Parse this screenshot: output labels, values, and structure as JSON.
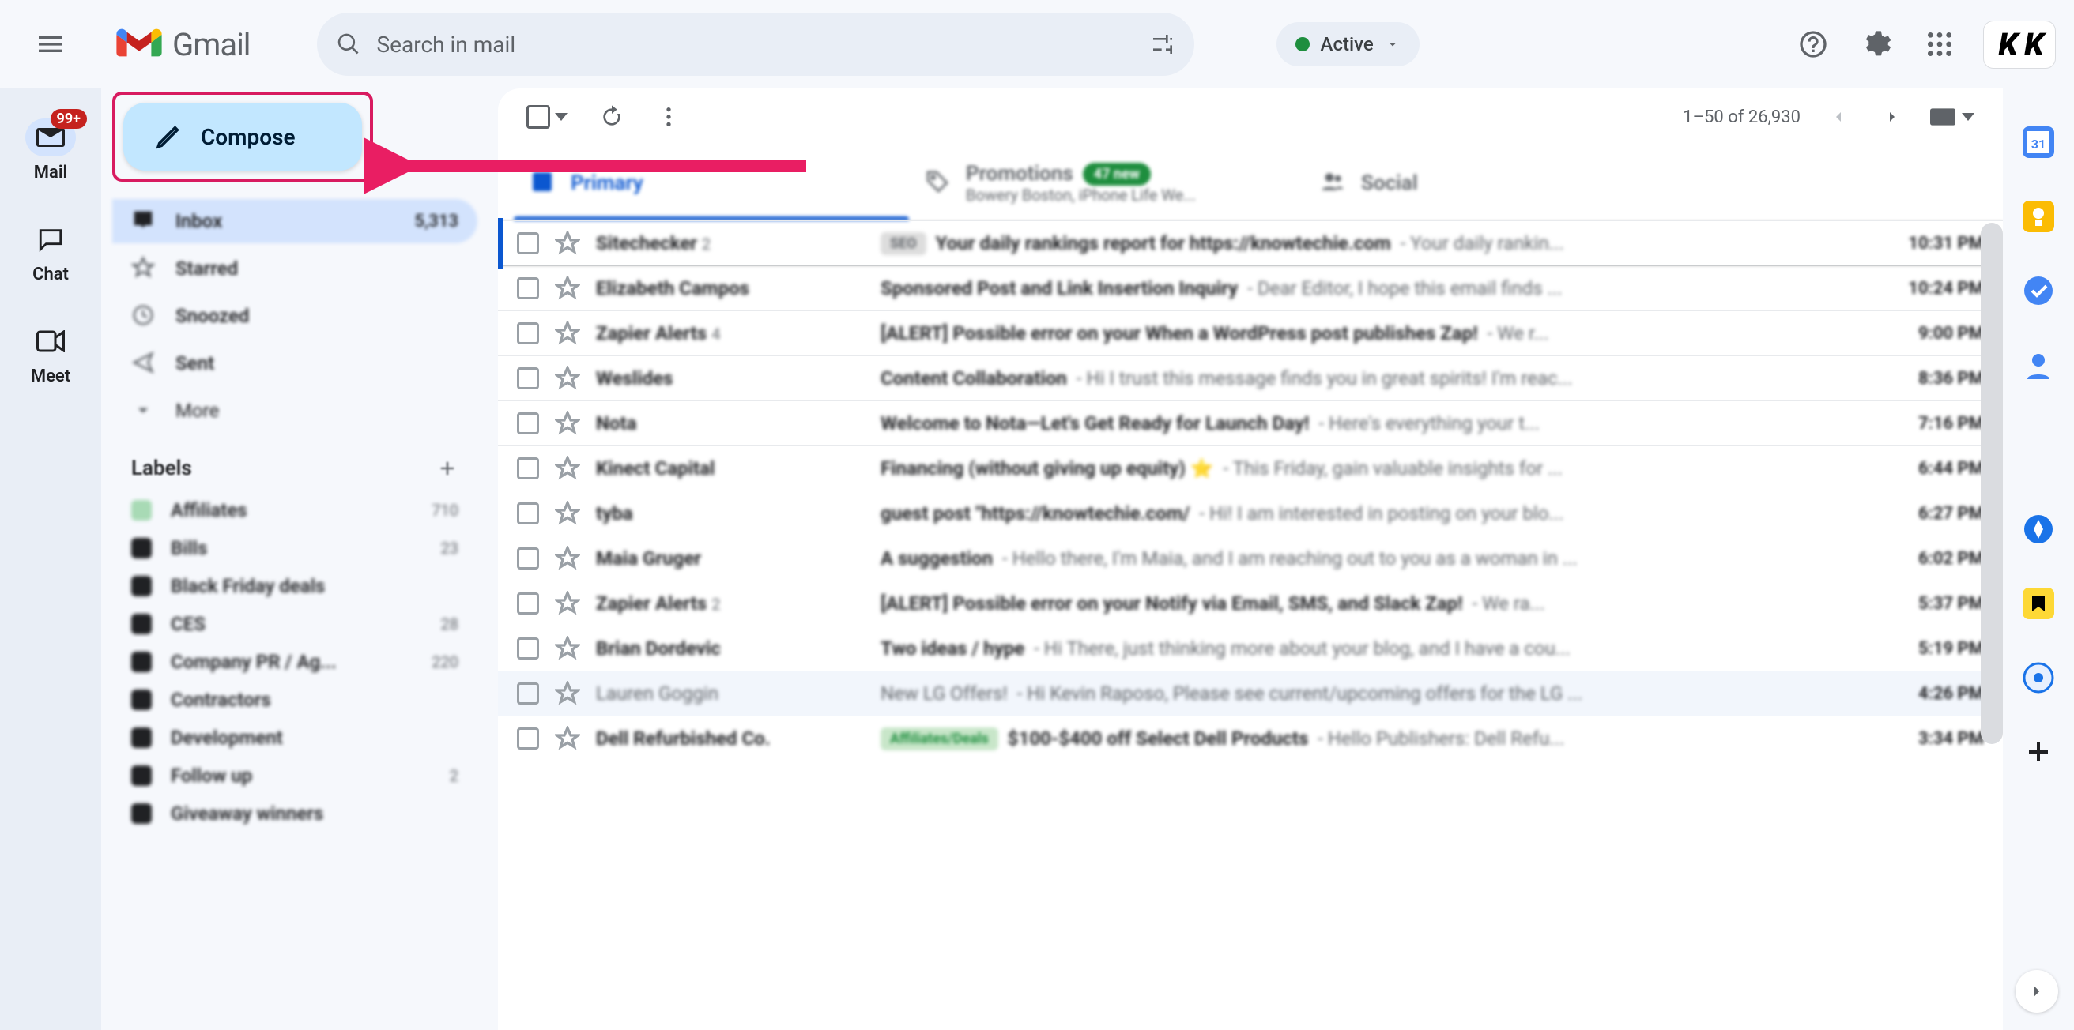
{
  "header": {
    "app": "Gmail",
    "search_placeholder": "Search in mail",
    "status": "Active"
  },
  "rail": {
    "mail": "Mail",
    "mail_badge": "99+",
    "chat": "Chat",
    "meet": "Meet"
  },
  "sidebar": {
    "compose": "Compose",
    "folders": [
      {
        "icon": "inbox",
        "label": "Inbox",
        "count": "5,313",
        "active": true
      },
      {
        "icon": "star",
        "label": "Starred",
        "count": ""
      },
      {
        "icon": "clock",
        "label": "Snoozed",
        "count": ""
      },
      {
        "icon": "send",
        "label": "Sent",
        "count": ""
      },
      {
        "icon": "more",
        "label": "More",
        "count": ""
      }
    ],
    "labels_header": "Labels",
    "labels": [
      {
        "color": "#a8dab5",
        "label": "Affiliates",
        "count": "710"
      },
      {
        "color": "#202124",
        "label": "Bills",
        "count": "23"
      },
      {
        "color": "#202124",
        "label": "Black Friday deals",
        "count": ""
      },
      {
        "color": "#202124",
        "label": "CES",
        "count": "28"
      },
      {
        "color": "#202124",
        "label": "Company PR / Ag...",
        "count": "220"
      },
      {
        "color": "#202124",
        "label": "Contractors",
        "count": ""
      },
      {
        "color": "#202124",
        "label": "Development",
        "count": ""
      },
      {
        "color": "#202124",
        "label": "Follow up",
        "count": "2"
      },
      {
        "color": "#202124",
        "label": "Giveaway winners",
        "count": ""
      }
    ]
  },
  "toolbar": {
    "page_range": "1–50 of 26,930"
  },
  "tabs": [
    {
      "label": "Primary",
      "active": true,
      "icon": "inbox"
    },
    {
      "label": "Promotions",
      "badge": "47 new",
      "sub": "Bowery Boston, iPhone Life We...",
      "icon": "tag"
    },
    {
      "label": "Social",
      "icon": "people"
    }
  ],
  "emails": [
    {
      "unread": true,
      "sender": "Sitechecker",
      "sc": "2",
      "tag": "SEO",
      "subject": "Your daily rankings report for https://knowtechie.com",
      "snippet": " - Your daily rankin...",
      "time": "10:31 PM",
      "marker": true
    },
    {
      "unread": true,
      "sender": "Elizabeth Campos",
      "subject": "Sponsored Post and Link Insertion Inquiry",
      "snippet": " - Dear Editor, I hope this email finds ...",
      "time": "10:24 PM"
    },
    {
      "unread": true,
      "sender": "Zapier Alerts",
      "sc": "4",
      "subject": "[ALERT] Possible error on your When a WordPress post publishes Zap!",
      "snippet": " - We r...",
      "time": "9:00 PM"
    },
    {
      "unread": true,
      "sender": "Weslides",
      "subject": "Content Collaboration",
      "snippet": " - Hi I trust this message finds you in great spirits! I'm reac...",
      "time": "8:36 PM"
    },
    {
      "unread": true,
      "sender": "Nota",
      "subject": "Welcome to Nota—Let's Get Ready for Launch Day!",
      "snippet": " - Here's everything your t...",
      "time": "7:16 PM"
    },
    {
      "unread": true,
      "sender": "Kinect Capital",
      "subject": "Financing (without giving up equity) ⭐",
      "snippet": " - This Friday, gain valuable insights for ...",
      "time": "6:44 PM"
    },
    {
      "unread": true,
      "sender": "tyba",
      "subject": "guest post \"https://knowtechie.com/",
      "snippet": " - Hi! I am interested in posting on your blo...",
      "time": "6:27 PM"
    },
    {
      "unread": true,
      "sender": "Maia Gruger",
      "subject": "A suggestion",
      "snippet": " - Hello there, I'm Maia, and I am reaching out to you as a woman in ...",
      "time": "6:02 PM"
    },
    {
      "unread": true,
      "sender": "Zapier Alerts",
      "sc": "2",
      "subject": "[ALERT] Possible error on your Notify via Email, SMS, and Slack Zap!",
      "snippet": " - We ra...",
      "time": "5:37 PM"
    },
    {
      "unread": true,
      "sender": "Brian Dordevic",
      "subject": "Two ideas / hype",
      "snippet": " - Hi There, just thinking more about your blog, and I have a cou...",
      "time": "5:19 PM"
    },
    {
      "unread": false,
      "sender": "Lauren Goggin",
      "subject": "New LG Offers!",
      "snippet": " - Hi Kevin Raposo, Please see current/upcoming offers for the LG ...",
      "time": "4:26 PM"
    },
    {
      "unread": true,
      "sender": "Dell Refurbished Co.",
      "tag": "Affiliates/Deals",
      "tagClass": "green",
      "subject": "$100-$400 off Select Dell Products",
      "snippet": " - Hello Publishers: Dell Refu...",
      "time": "3:34 PM"
    }
  ]
}
